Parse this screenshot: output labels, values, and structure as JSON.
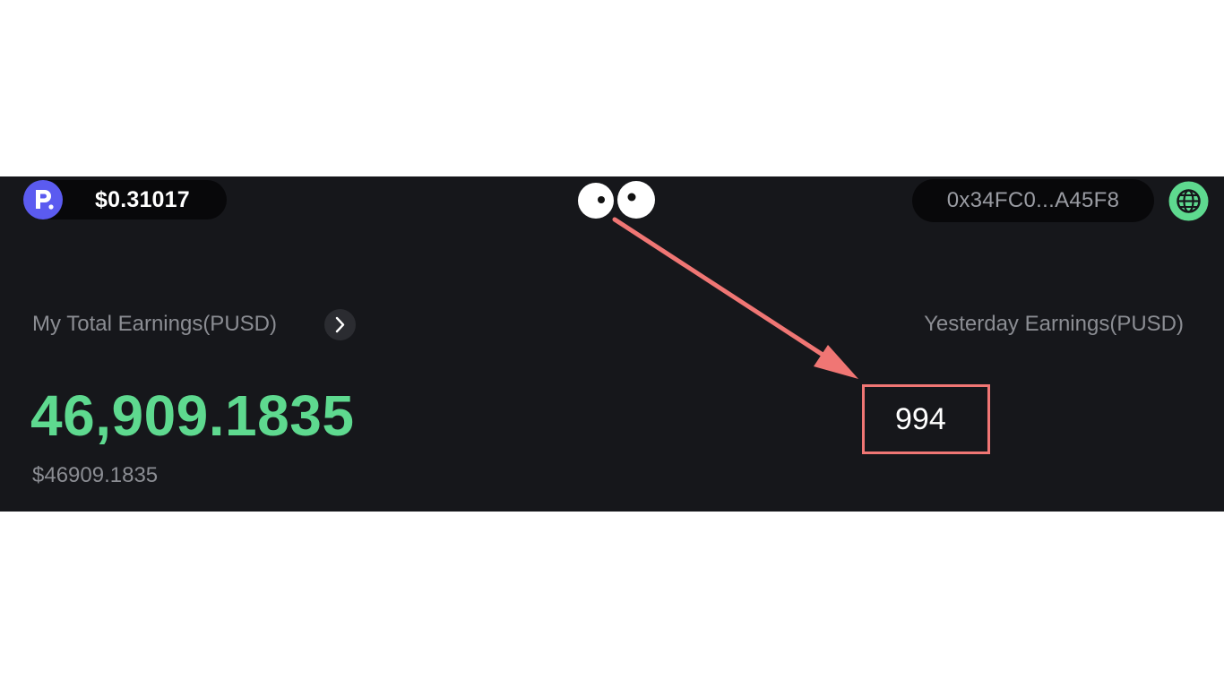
{
  "header": {
    "token_price": "$0.31017",
    "wallet_address": "0x34FC0...A45F8"
  },
  "earnings": {
    "total_label": "My Total Earnings(PUSD)",
    "total_value": "46,909.1835",
    "total_usd": "$46909.1835",
    "yesterday_label": "Yesterday Earnings(PUSD)",
    "yesterday_value": "994"
  },
  "icons": {
    "logo": "p-logo-icon",
    "mascot": "eyes-icon",
    "language": "globe-icon",
    "details": "chevron-right-icon"
  },
  "colors": {
    "background": "#16171b",
    "accent_green": "#5ed98f",
    "logo_purple": "#5b5bf0",
    "annotation_red": "#f07674"
  }
}
